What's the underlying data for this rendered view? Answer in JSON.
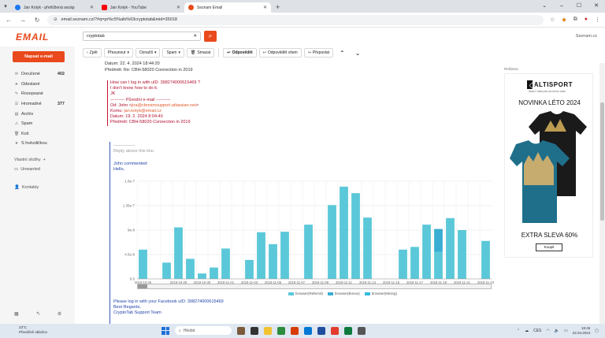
{
  "browser": {
    "tabs": [
      {
        "label": "Jan Kotyk - přehlížená sezáp",
        "color": "#1877f2",
        "active": false
      },
      {
        "label": "Jan Kotyk - YouTube",
        "color": "#ff0000",
        "active": false
      },
      {
        "label": "Seznam Email",
        "color": "#e9491c",
        "active": true
      }
    ],
    "new_tab": "+",
    "url": "email.seznam.cz/?#q=pr%c5%afs%63cryptotab&mid=35018"
  },
  "app": {
    "logo": "EMAIL",
    "search_value": "cryptotab",
    "brand": "Seznam.cz",
    "compose_label": "Napsat e-mail"
  },
  "toolbar": {
    "back": "Zpět",
    "move": "Přesunout",
    "mark": "Označit",
    "spam": "Spam",
    "delete": "Smazat",
    "reply": "Odpovědět",
    "reply_all": "Odpovědět všem",
    "forward": "Přeposlat",
    "prev": "⌃",
    "next": "⌄"
  },
  "folders": [
    {
      "name": "Doručené",
      "count": "402",
      "icon": "✉"
    },
    {
      "name": "Odeslané",
      "count": "",
      "icon": "➤"
    },
    {
      "name": "Rozepsané",
      "count": "",
      "icon": "✎"
    },
    {
      "name": "Hromadné",
      "count": "377",
      "icon": "☰"
    },
    {
      "name": "Archiv",
      "count": "",
      "icon": "▤"
    },
    {
      "name": "Spam",
      "count": "",
      "icon": "⚠"
    },
    {
      "name": "Koš",
      "count": "",
      "icon": "🗑"
    },
    {
      "name": "S hvězdičkou",
      "count": "",
      "icon": "★"
    }
  ],
  "sidebar": {
    "labels_title": "Vlastní složky",
    "unwanted": "Unwanted",
    "contacts": "Kontakty"
  },
  "mail": {
    "date": "Datum: 22. 4. 2024 18:44:20",
    "subject": "Předmět: Re: CBH-58020 Connection in 2019",
    "quoted": {
      "q1": "How can I log in with uID: 398274000615469 ?",
      "q2": "I don't know how to do it.",
      "q3": "JK",
      "divider": "---------- Původní e-mail ----------",
      "from_prefix": "Od: John <",
      "from_email": "jira@cbresmsupport.atlassian.net",
      "from_suffix": ">",
      "to_prefix": "Komu: ",
      "to_email": "jan.kotyk@email.cz",
      "date": "Datum: 19. 2. 2024 8:04:40",
      "subject": "Předmět: CBH-58020 Connection in 2019"
    },
    "reply_marker": "—————",
    "reply_above": "Reply above this line.",
    "john_commented": "John commented:",
    "hello": "Hello,",
    "signoff_1": "Please log in with your Facebook uID: 398274000615469",
    "signoff_2": "Best Regards,",
    "signoff_3": "CryptoTab Support Team"
  },
  "chart_data": {
    "type": "bar",
    "categories": [
      "2019-10-25",
      "2019-10-26",
      "2019-10-27",
      "2019-10-28",
      "2019-10-29",
      "2019-10-30",
      "2019-10-31",
      "2019-11-01",
      "2019-11-02",
      "2019-11-03",
      "2019-11-04",
      "2019-11-05",
      "2019-11-06",
      "2019-11-07",
      "2019-11-08",
      "2019-11-09",
      "2019-11-10",
      "2019-11-11",
      "2019-11-12",
      "2019-11-13",
      "2019-11-14",
      "2019-11-15",
      "2019-11-16",
      "2019-11-17",
      "2019-11-18",
      "2019-11-19",
      "2019-11-20",
      "2019-11-21",
      "2019-11-22",
      "2019-11-23"
    ],
    "tick_labels": [
      "2019-10-25",
      "2019-10-28",
      "2019-10-30",
      "2019-11-01",
      "2019-11-03",
      "2019-11-05",
      "2019-11-07",
      "2019-11-09",
      "2019-11-11",
      "2019-11-13",
      "2019-11-15",
      "2019-11-17",
      "2019-11-19",
      "2019-11-21",
      "2019-11-23"
    ],
    "y_tick_labels": [
      "0.0",
      "4.5e-8",
      "9e-8",
      "1.35e-7",
      "1.8e-7"
    ],
    "ylim": [
      0,
      1.8e-07
    ],
    "grid": true,
    "legend_position": "bottom",
    "series": [
      {
        "name": "browser(Referral)",
        "color": "#5bc8d9",
        "values": [
          5.4e-08,
          0,
          3e-08,
          9.5e-08,
          3.7e-08,
          1e-08,
          2.1e-08,
          5.6e-08,
          0,
          3.5e-08,
          8.6e-08,
          6.4e-08,
          8.7e-08,
          0,
          1e-07,
          0,
          1.36e-07,
          1.7e-07,
          1.58e-07,
          1.13e-07,
          0,
          0,
          5.4e-08,
          5.9e-08,
          1e-07,
          5e-08,
          1.12e-07,
          9e-08,
          0,
          7e-08
        ]
      },
      {
        "name": "browser(Bonus)",
        "color": "#3aaed2",
        "values": [
          0,
          0,
          0,
          0,
          0,
          0,
          0,
          0,
          0,
          0,
          0,
          0,
          0,
          0,
          0,
          0,
          0,
          0,
          0,
          0,
          0,
          0,
          0,
          0,
          0,
          4.2e-08,
          0,
          0,
          0,
          0
        ]
      },
      {
        "name": "browser(Mining)",
        "color": "#36bde0",
        "values": [
          0,
          0,
          0,
          0,
          0,
          0,
          0,
          0,
          0,
          0,
          0,
          0,
          0,
          0,
          0,
          0,
          0,
          0,
          0,
          0,
          0,
          0,
          0,
          0,
          0,
          0,
          0,
          0,
          0,
          0
        ]
      }
    ]
  },
  "ad": {
    "label": "Reklama",
    "brand": "ALTISPORT",
    "brand_sub": "ČESKÝ OBCHOD OD ROKU 1998",
    "title": "NOVINKA LÉTO 2024",
    "sale": "EXTRA SLEVA 60%",
    "button": "Koupit",
    "shirt_back_color": "#1a1a1a",
    "shirt_front_color": "#1f6f8b"
  },
  "taskbar": {
    "weather_temp": "23°C",
    "weather_desc": "Převážně oblačno",
    "search_placeholder": "Hledat",
    "lang": "CES",
    "time": "18:45",
    "date": "22.04.2024"
  }
}
